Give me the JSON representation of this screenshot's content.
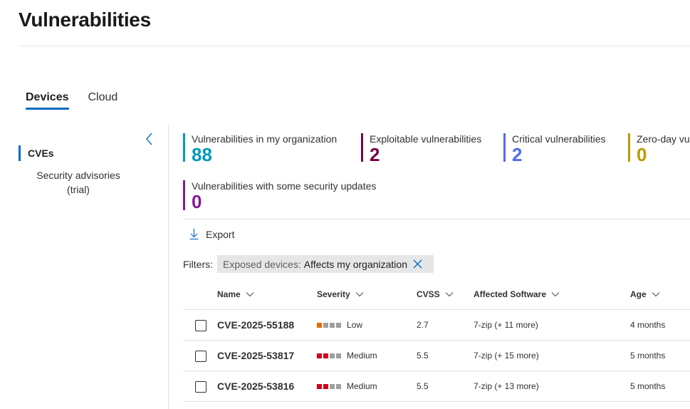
{
  "page": {
    "title": "Vulnerabilities"
  },
  "tabs": [
    {
      "label": "Devices",
      "active": true
    },
    {
      "label": "Cloud",
      "active": false
    }
  ],
  "left_nav": {
    "items": [
      {
        "label": "CVEs",
        "active": true
      },
      {
        "label": "Security advisories (trial)",
        "lines": [
          "Security advisories",
          "(trial)"
        ],
        "active": false
      }
    ]
  },
  "summary": [
    {
      "label": "Vulnerabilities in my organization",
      "value": "88",
      "color": "#0099bc"
    },
    {
      "label": "Exploitable vulnerabilities",
      "value": "2",
      "color": "#770044"
    },
    {
      "label": "Critical vulnerabilities",
      "value": "2",
      "color": "#4f6bed"
    },
    {
      "label": "Zero-day vu",
      "value": "0",
      "color": "#b79b00"
    },
    {
      "label": "Vulnerabilities with some security updates",
      "value": "0",
      "color": "#881798"
    }
  ],
  "toolbar": {
    "export_label": "Export"
  },
  "filters": {
    "label": "Filters:",
    "chips": [
      {
        "key": "Exposed devices",
        "separator": ":",
        "value": "Affects my organization"
      }
    ]
  },
  "table": {
    "columns": [
      "Name",
      "Severity",
      "CVSS",
      "Affected Software",
      "Age"
    ],
    "rows": [
      {
        "name": "CVE-2025-55188",
        "severity": "Low",
        "severity_level": 1,
        "severity_color": "#e66c00",
        "cvss": "2.7",
        "software": "7-zip (+ 11 more)",
        "age": "4 months"
      },
      {
        "name": "CVE-2025-53817",
        "severity": "Medium",
        "severity_level": 2,
        "severity_color": "#d0021b",
        "cvss": "5.5",
        "software": "7-zip (+ 15 more)",
        "age": "5 months"
      },
      {
        "name": "CVE-2025-53816",
        "severity": "Medium",
        "severity_level": 2,
        "severity_color": "#d0021b",
        "cvss": "5.5",
        "software": "7-zip (+ 13 more)",
        "age": "5 months"
      }
    ]
  },
  "colors": {
    "accent": "#0f6cbd",
    "severity_inactive": "#a19f9d"
  }
}
